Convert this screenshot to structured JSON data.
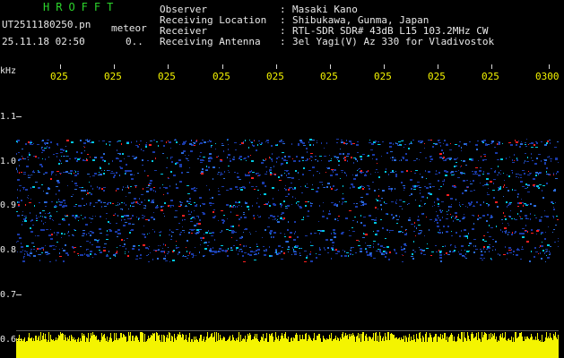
{
  "header": {
    "app_name": "HROFFT",
    "filename": "UT2511180250.pn",
    "mode": "meteor",
    "datetime": "25.11.18 02:50",
    "count": "0.."
  },
  "info": {
    "labels": [
      "Observer",
      "Receiving Location",
      "Receiver",
      "Receiving Antenna"
    ],
    "separator": ":",
    "values": [
      "Masaki Kano",
      "Shibukawa, Gunma, Japan",
      "RTL-SDR SDR# 43dB L15 103.2MHz CW",
      "3el Yagi(V) Az 330 for Vladivostok"
    ]
  },
  "axes": {
    "y_unit": "kHz",
    "y_ticks": [
      "1.1",
      "1.0",
      "0.9",
      "0.8",
      "0.7",
      "0.6"
    ],
    "x_ticks": [
      "025",
      "025",
      "025",
      "025",
      "025",
      "025",
      "025",
      "025",
      "025",
      "0300"
    ]
  },
  "colors": {
    "background": "#000000",
    "label_white": "#e8e8e8",
    "tick_yellow": "#f4f400",
    "title_green": "#2cd52c",
    "signal_blue": "#1a3aa8",
    "signal_cyan": "#00c8e0",
    "signal_red": "#ff2020"
  }
}
